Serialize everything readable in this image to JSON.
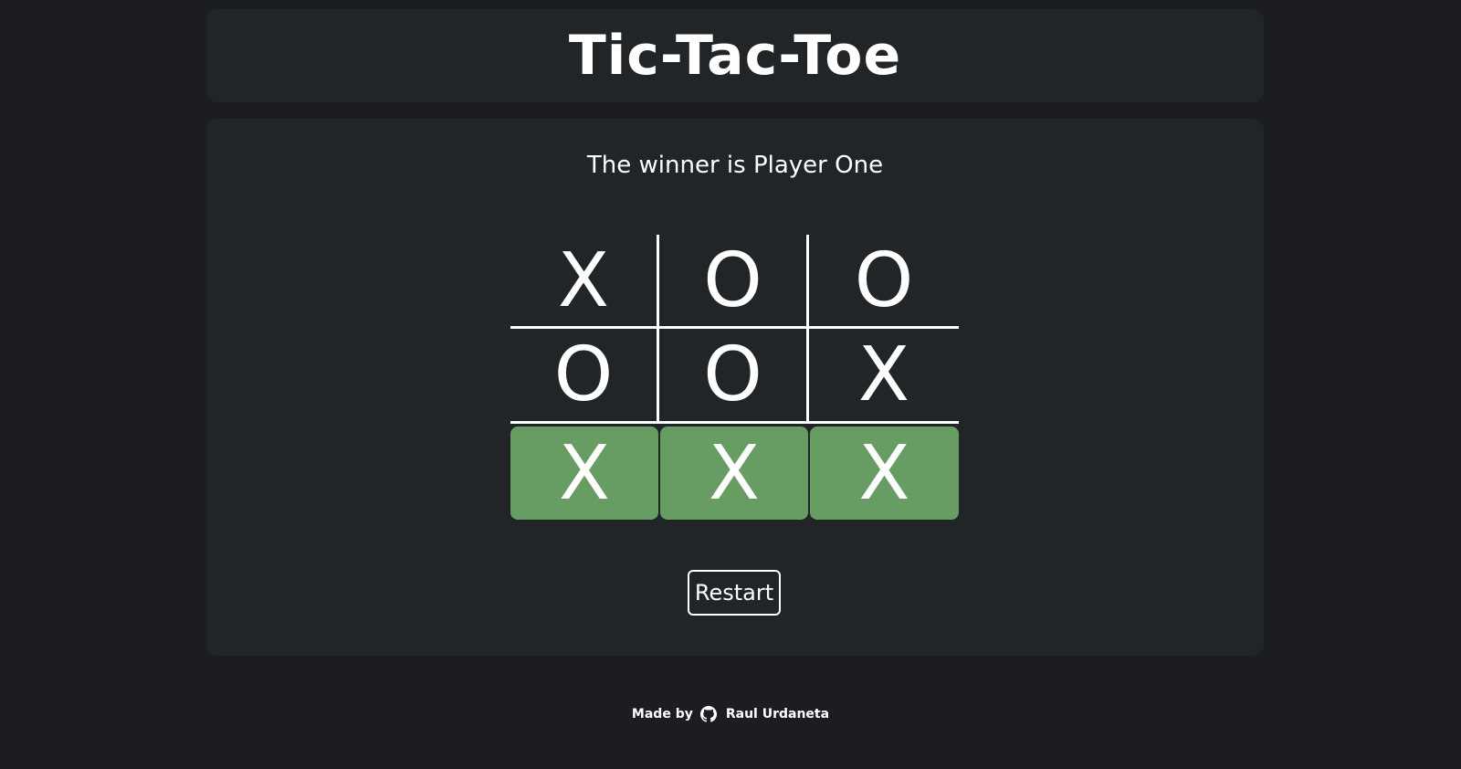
{
  "header": {
    "title": "Tic-Tac-Toe"
  },
  "game": {
    "status": "The winner is Player One",
    "board": [
      [
        "X",
        "O",
        "O"
      ],
      [
        "O",
        "O",
        "X"
      ],
      [
        "X",
        "X",
        "X"
      ]
    ],
    "winning_row": 2,
    "restart_label": "Restart"
  },
  "footer": {
    "made_by": "Made by",
    "author": "Raul Urdaneta",
    "icon": "github-icon"
  },
  "colors": {
    "background": "#1b1d21",
    "card": "#212528",
    "win_highlight": "#679c63",
    "text": "#ffffff"
  }
}
